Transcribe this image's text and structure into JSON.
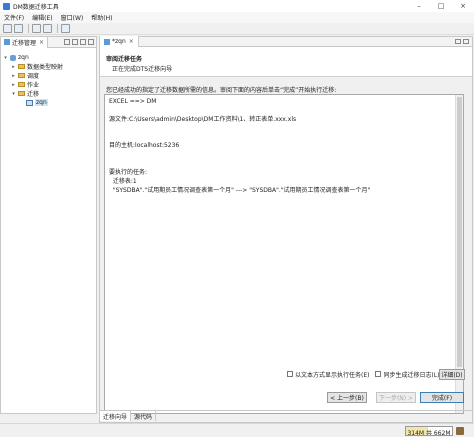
{
  "window": {
    "title": "DM数据迁移工具",
    "minimize": "–",
    "maximize": "□",
    "close": "×"
  },
  "menu": [
    "文件(F)",
    "编辑(E)",
    "窗口(W)",
    "帮助(H)"
  ],
  "left_panel": {
    "tab_label": "迁移管理",
    "tree": [
      {
        "label": "zqn",
        "level": 0,
        "expanded": true,
        "icon": "database-icon"
      },
      {
        "label": "数据类型映射",
        "level": 1,
        "expanded": false,
        "icon": "folder-icon"
      },
      {
        "label": "调度",
        "level": 1,
        "expanded": false,
        "icon": "folder-icon"
      },
      {
        "label": "作业",
        "level": 1,
        "expanded": false,
        "icon": "folder-icon"
      },
      {
        "label": "迁移",
        "level": 1,
        "expanded": true,
        "icon": "folder-icon"
      },
      {
        "label": "zqn",
        "level": 2,
        "selected": true,
        "icon": "migration-task-icon"
      }
    ]
  },
  "editor": {
    "tab_label": "*zqn",
    "wizard": {
      "title": "审阅迁移任务",
      "subtitle": "正在完成DTS迁移向导",
      "prompt": "您已经成功的指定了迁移数据所需的信息。审阅下面的内容后单击“完成”开始执行迁移:",
      "summary_lines": [
        "EXCEL ==> DM",
        "",
        "源文件:C:\\Users\\admin\\Desktop\\DM工作资料\\1、转正表单.xxx.xls",
        "",
        "",
        "目的主机:localhost:5236",
        "",
        "",
        "要执行的任务:",
        "  迁移表:1",
        "  \"SYSDBA\".\"试用期员工情况调查表第一个月\" ---> \"SYSDBA\".\"试用期员工情况调查表第一个月\""
      ],
      "option_text_mode": "以文本方式显示执行任务(E)",
      "option_sync_log": "同步生成迁移日志(L)",
      "details_label": "详细(D)",
      "back_label": "< 上一步(B)",
      "next_label": "下一步(N) >",
      "finish_label": "完成(F)"
    },
    "bottom_tabs": [
      "迁移向导",
      "源代码"
    ]
  },
  "status": {
    "heap_text": "314M 共 662M",
    "heap_used_fraction": 0.47
  }
}
